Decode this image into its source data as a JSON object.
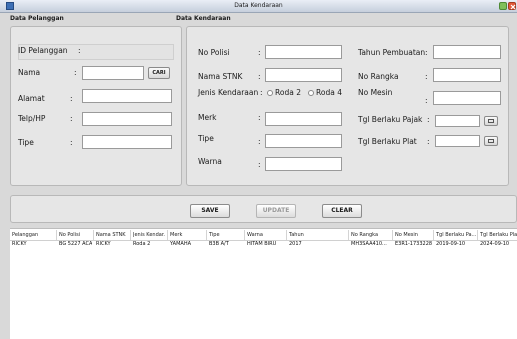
{
  "window": {
    "title": "Data Kendaraan"
  },
  "pelanggan": {
    "section_title": "Data Pelanggan",
    "id_label": "ID Pelanggan",
    "nama_label": "Nama",
    "cari_label": "CARI",
    "alamat_label": "Alamat",
    "telp_label": "Telp/HP",
    "tipe_label": "Tipe"
  },
  "kendaraan": {
    "section_title": "Data Kendaraan",
    "no_polisi_label": "No Polisi",
    "nama_stnk_label": "Nama STNK",
    "jenis_label": "Jenis Kendaraan",
    "roda2_label": "Roda 2",
    "roda4_label": "Roda 4",
    "merk_label": "Merk",
    "tipe_label": "Tipe",
    "warna_label": "Warna",
    "tahun_label": "Tahun Pembuatan",
    "no_rangka_label": "No Rangka",
    "no_mesin_label": "No Mesin",
    "tgl_pajak_label": "Tgl Berlaku Pajak",
    "tgl_plat_label": "Tgl Berlaku Plat"
  },
  "colon": ":",
  "actions": {
    "save": "SAVE",
    "update": "UPDATE",
    "clear": "CLEAR"
  },
  "table": {
    "columns": [
      "Pelanggan",
      "No Polisi",
      "Nama STNK",
      "Jenis Kendar...",
      "Merk",
      "Tipe",
      "Warna",
      "Tahun",
      "No Rangka",
      "No Mesin",
      "Tgl Berlaku Pa...",
      "Tgl Berlaku Plat"
    ],
    "rows": [
      [
        "RICKY",
        "BG 5227 ACA",
        "RICKY",
        "Roda 2",
        "YAMAHA",
        "B3B A/T",
        "HITAM BIRU",
        "2017",
        "MH3SAA410...",
        "E3R1-1733228",
        "2019-09-10",
        "2024-09-10"
      ]
    ]
  }
}
